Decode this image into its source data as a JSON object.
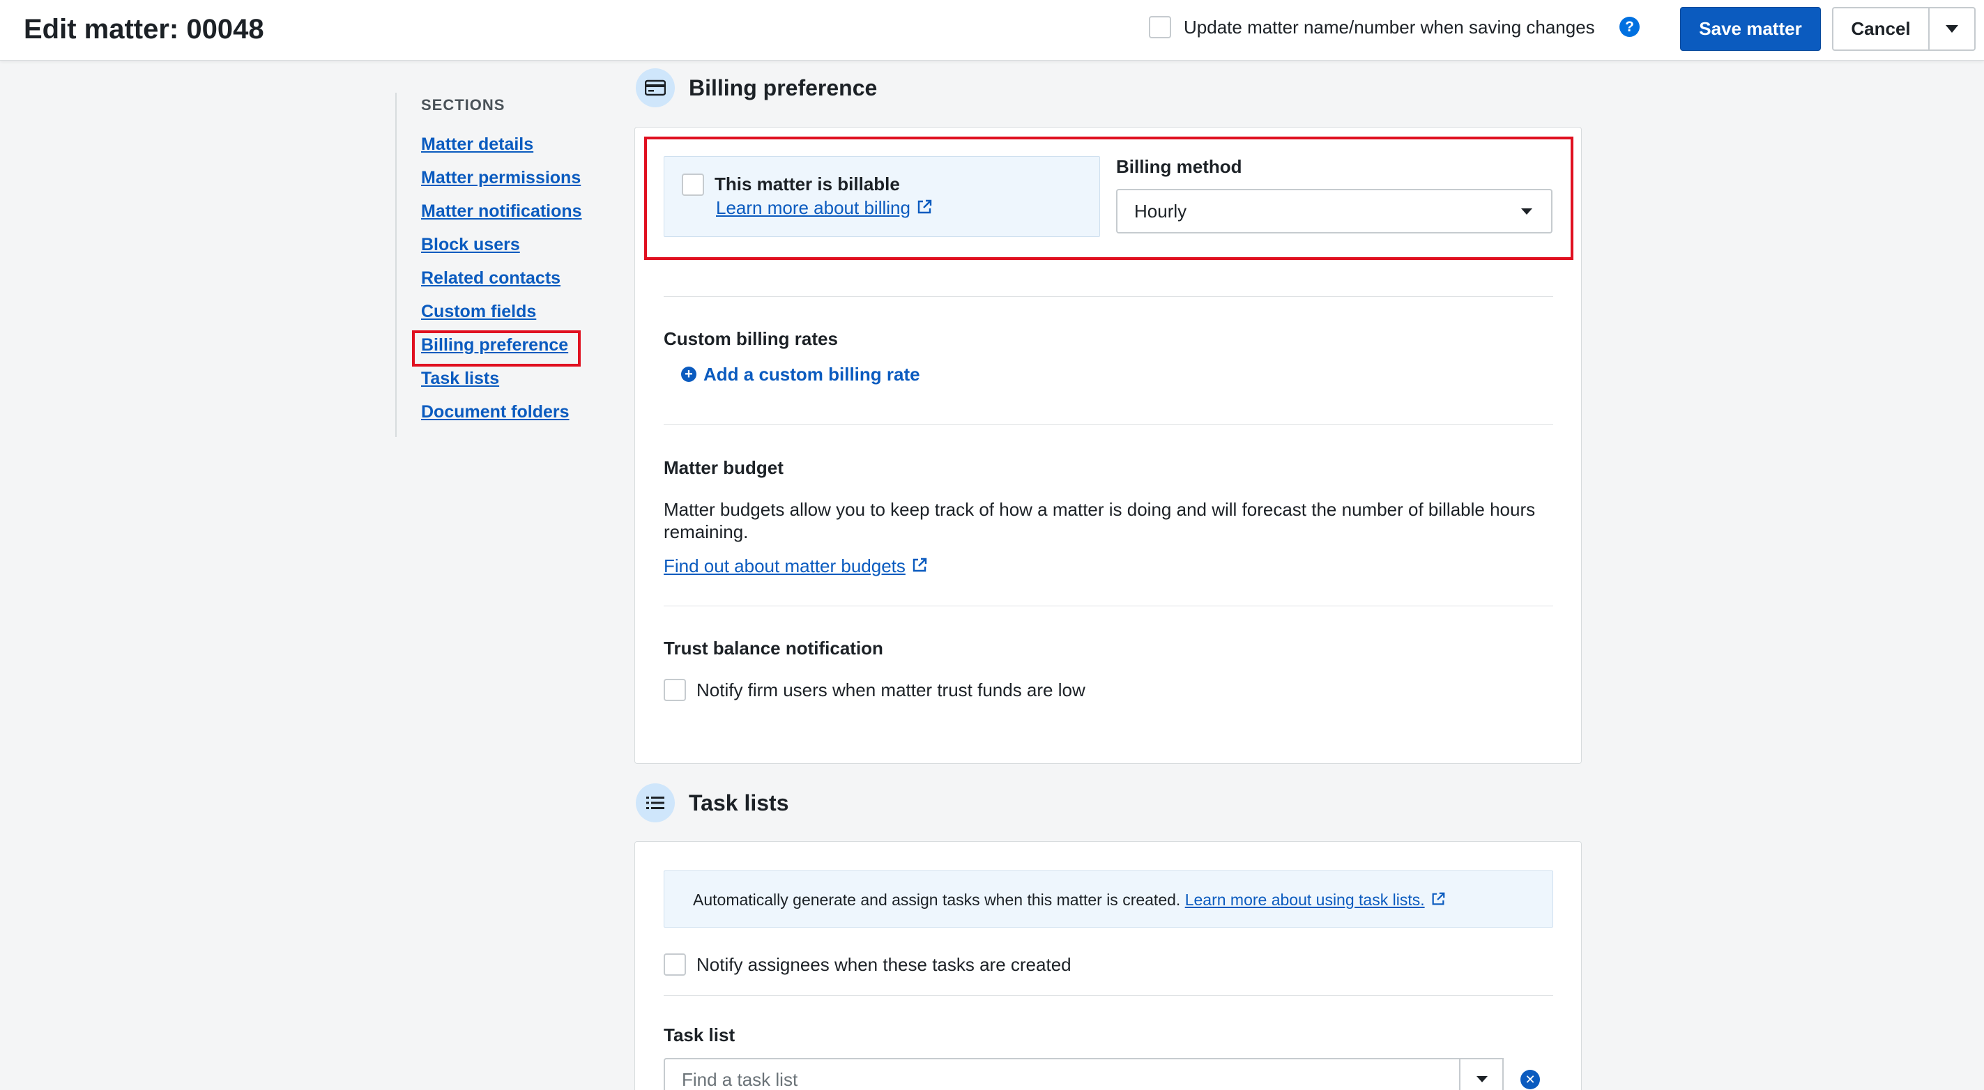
{
  "header": {
    "title": "Edit matter: 00048",
    "update_label": "Update matter name/number when saving changes",
    "help_icon": "?",
    "save_label": "Save matter",
    "cancel_label": "Cancel"
  },
  "sidebar": {
    "title": "SECTIONS",
    "items": [
      {
        "label": "Matter details"
      },
      {
        "label": "Matter permissions"
      },
      {
        "label": "Matter notifications"
      },
      {
        "label": "Block users"
      },
      {
        "label": "Related contacts"
      },
      {
        "label": "Custom fields"
      },
      {
        "label": "Billing preference"
      },
      {
        "label": "Task lists"
      },
      {
        "label": "Document folders"
      }
    ],
    "active": "Billing preference"
  },
  "billing": {
    "section_title": "Billing preference",
    "icon": "credit-card-icon",
    "billable_label": "This matter is billable",
    "billable_checked": false,
    "learn_link": "Learn more about billing",
    "method_label": "Billing method",
    "method_value": "Hourly",
    "custom_rates_title": "Custom billing rates",
    "add_rate_label": "Add a custom billing rate",
    "budget_title": "Matter budget",
    "budget_desc_line1": "Matter budgets allow you to keep track of how a matter is doing and will forecast the number of billable hours",
    "budget_desc_line2": "remaining.",
    "budget_link": "Find out about matter budgets",
    "trust_title": "Trust balance notification",
    "trust_label": "Notify firm users when matter trust funds are low"
  },
  "tasks": {
    "section_title": "Task lists",
    "icon": "list-icon",
    "banner_text": "Automatically generate and assign tasks when this matter is created.",
    "banner_link": "Learn more about using task lists.",
    "notify_label": "Notify assignees when these tasks are created",
    "task_list_title": "Task list",
    "task_list_placeholder": "Find a task list"
  },
  "colors": {
    "primary": "#0b5bbf",
    "highlight": "#e01020",
    "icon_bg": "#cfe6fb",
    "banner_bg": "#eef6fd"
  }
}
